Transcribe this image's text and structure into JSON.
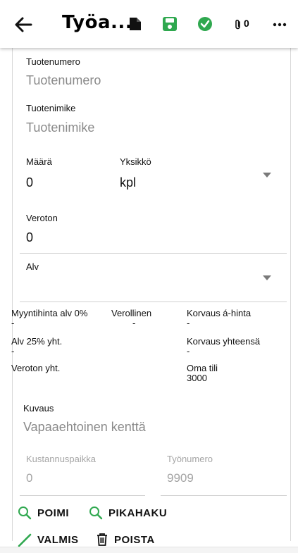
{
  "header": {
    "title": "Työa...",
    "attachment_count": "0",
    "colors": {
      "save": "#2fa84f",
      "check": "#2fa84f"
    }
  },
  "form": {
    "tuotenumero": {
      "label": "Tuotenumero",
      "placeholder": "Tuotenumero"
    },
    "tuotenimike": {
      "label": "Tuotenimike",
      "placeholder": "Tuotenimike"
    },
    "maara": {
      "label": "Määrä",
      "value": "0"
    },
    "yksikko": {
      "label": "Yksikkö",
      "value": "kpl"
    },
    "veroton": {
      "label": "Veroton",
      "value": "0"
    },
    "alv": {
      "label": "Alv",
      "value": ""
    }
  },
  "summary": {
    "myyntihinta": {
      "label": "Myyntihinta alv 0%",
      "value": "-"
    },
    "verollinen": {
      "label": "Verollinen",
      "value": "-"
    },
    "korvaus_a_hinta": {
      "label": "Korvaus á-hinta",
      "value": "-"
    },
    "alv25": {
      "label": "Alv 25% yht.",
      "value": "-"
    },
    "korvaus_yhteensa": {
      "label": "Korvaus yhteensä",
      "value": "-"
    },
    "veroton_yht": {
      "label": "Veroton yht.",
      "value": ""
    },
    "oma_tili": {
      "label": "Oma tili",
      "value": "3000"
    }
  },
  "kuvaus": {
    "label": "Kuvaus",
    "placeholder": "Vapaaehtoinen kenttä"
  },
  "kustannuspaikka": {
    "label": "Kustannuspaikka",
    "value": "0"
  },
  "tyonumero": {
    "label": "Työnumero",
    "value": "9909"
  },
  "actions": {
    "poimi": "POIMI",
    "pikahaku": "PIKAHAKU",
    "valmis": "VALMIS",
    "poista": "POISTA",
    "colors": {
      "search": "#2fa84f",
      "valmis": "#2fa84f"
    }
  }
}
